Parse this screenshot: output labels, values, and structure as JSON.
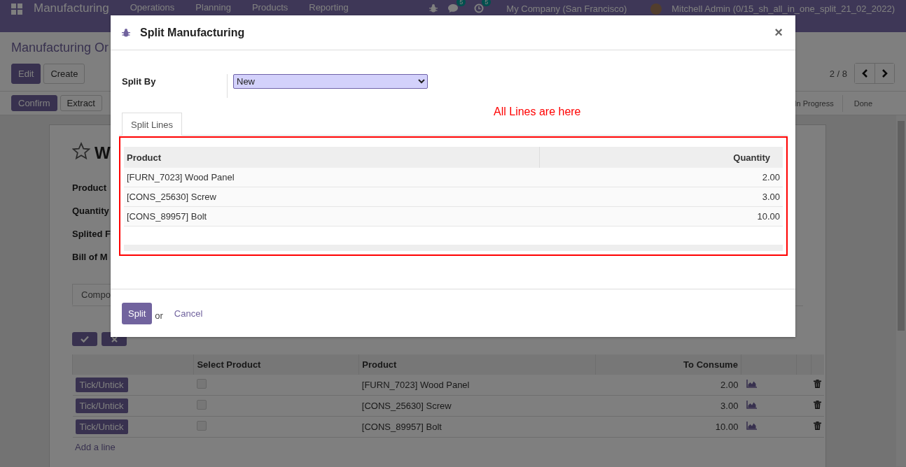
{
  "navbar": {
    "app_name": "Manufacturing",
    "menus": [
      "Operations",
      "Planning",
      "Products",
      "Reporting"
    ],
    "chat_badge": "5",
    "activity_badge": "5",
    "company": "My Company (San Francisco)",
    "user": "Mitchell Admin (0/15_sh_all_in_one_split_21_02_2022)"
  },
  "control_panel": {
    "breadcrumb": "Manufacturing Or",
    "buttons": [
      {
        "label": "Edit",
        "kind": "primary"
      },
      {
        "label": "Create",
        "kind": "secondary"
      }
    ],
    "pager": "2 / 8"
  },
  "status_bar": {
    "actions": [
      {
        "label": "Confirm",
        "kind": "primary"
      },
      {
        "label": "Extract",
        "kind": "secondary"
      }
    ],
    "stages": [
      {
        "label": "In Progress",
        "selected": false
      },
      {
        "label": "Done",
        "selected": false
      }
    ]
  },
  "form": {
    "title": "W",
    "starred": false,
    "fields": [
      "Product",
      "Quantity",
      "Splited F",
      "Bill of M"
    ],
    "tab": "Compo",
    "table": {
      "columns": [
        "",
        "Select Product",
        "Product",
        "To Consume"
      ],
      "rows": [
        {
          "button": "Tick/Untick",
          "checked": false,
          "product": "[FURN_7023] Wood Panel",
          "to_consume": "2.00"
        },
        {
          "button": "Tick/Untick",
          "checked": false,
          "product": "[CONS_25630] Screw",
          "to_consume": "3.00"
        },
        {
          "button": "Tick/Untick",
          "checked": false,
          "product": "[CONS_89957] Bolt",
          "to_consume": "10.00"
        }
      ],
      "add_line": "Add a line"
    }
  },
  "dialog": {
    "title": "Split Manufacturing",
    "close": "×",
    "split_by_label": "Split By",
    "split_by_value": "New",
    "tab": {
      "label": "Split Lines",
      "selected": true
    },
    "annotation": "All Lines are here",
    "table": {
      "columns": [
        "Product",
        "Quantity"
      ],
      "rows": [
        {
          "product": "[FURN_7023] Wood Panel",
          "quantity": "2.00"
        },
        {
          "product": "[CONS_25630] Screw",
          "quantity": "3.00"
        },
        {
          "product": "[CONS_89957] Bolt",
          "quantity": "10.00"
        }
      ]
    },
    "footer": {
      "primary": "Split",
      "separator": "or",
      "cancel": "Cancel"
    }
  }
}
